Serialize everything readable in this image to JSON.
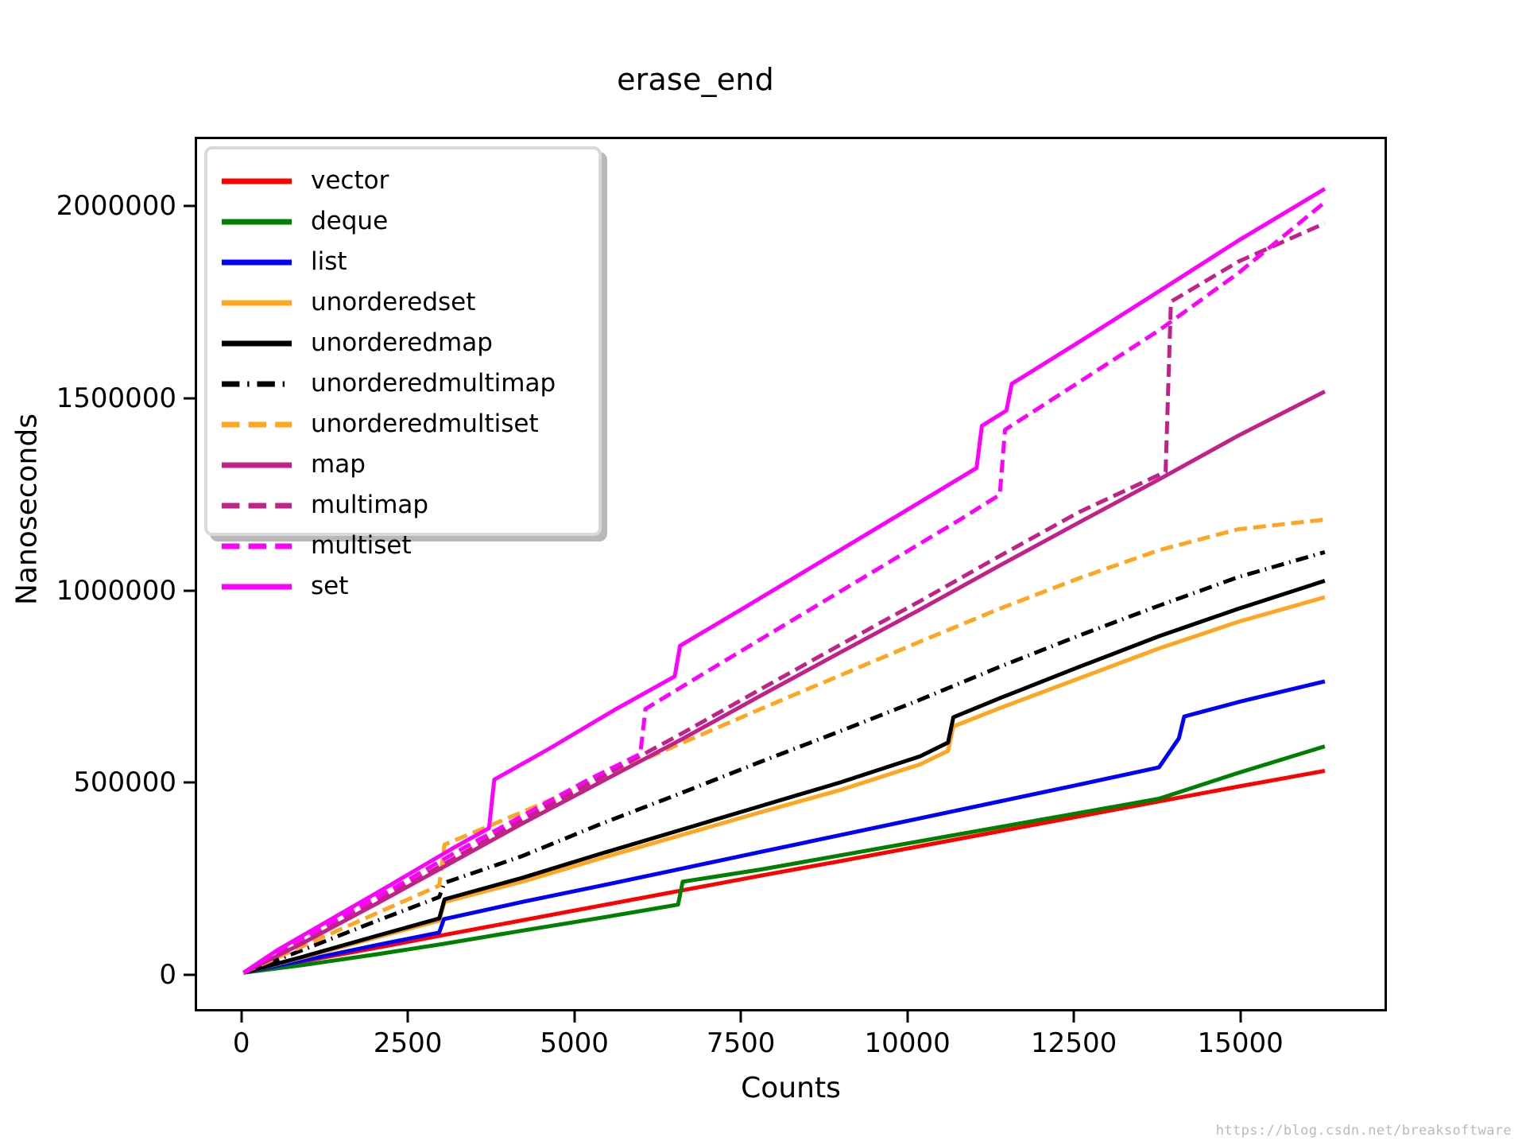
{
  "chart_data": {
    "type": "line",
    "title": "erase_end",
    "xlabel": "Counts",
    "ylabel": "Nanoseconds",
    "xlim": [
      -700,
      17200
    ],
    "ylim": [
      -95000,
      2180000
    ],
    "xticks": [
      0,
      2500,
      5000,
      7500,
      10000,
      12500,
      15000
    ],
    "xticklabels": [
      "0",
      "2500",
      "5000",
      "7500",
      "10000",
      "12500",
      "15000"
    ],
    "yticks": [
      0,
      500000,
      1000000,
      1500000,
      2000000
    ],
    "yticklabels": [
      "0",
      "500000",
      "1000000",
      "1500000",
      "2000000"
    ],
    "grid": false,
    "legend_position": "upper left",
    "series": [
      {
        "name": "vector",
        "color": "#ff0000",
        "style": "solid",
        "x": [
          0,
          900,
          2000,
          3000,
          4200,
          5400,
          6600,
          7800,
          9000,
          10200,
          11400,
          12600,
          13800,
          15000,
          16300
        ],
        "values": [
          0,
          30000,
          65000,
          98000,
          137000,
          176000,
          215000,
          254000,
          292000,
          331000,
          370000,
          409000,
          448000,
          487000,
          528000
        ]
      },
      {
        "name": "deque",
        "color": "#008000",
        "style": "solid",
        "x": [
          0,
          900,
          2000,
          3000,
          4200,
          5400,
          6550,
          6620,
          7800,
          9000,
          10200,
          11400,
          12600,
          13800,
          15000,
          16300
        ],
        "values": [
          0,
          20000,
          48000,
          75000,
          110000,
          144000,
          178000,
          238000,
          270000,
          307000,
          344000,
          381000,
          418000,
          455000,
          523000,
          592000
        ]
      },
      {
        "name": "list",
        "color": "#0000ff",
        "style": "solid",
        "x": [
          0,
          900,
          2000,
          2950,
          3020,
          4200,
          5400,
          6600,
          7800,
          9000,
          10200,
          11400,
          12600,
          13800,
          14100,
          14180,
          15000,
          16300
        ],
        "values": [
          0,
          32000,
          72000,
          105000,
          140000,
          185000,
          228000,
          272000,
          316000,
          360000,
          404000,
          448000,
          492000,
          537000,
          613000,
          670000,
          708000,
          762000
        ]
      },
      {
        "name": "unorderedset",
        "color": "#ffa51e",
        "style": "solid",
        "x": [
          0,
          900,
          2000,
          2950,
          3030,
          4200,
          5400,
          6600,
          7800,
          9000,
          10200,
          10620,
          10700,
          11400,
          12600,
          13800,
          15000,
          16300
        ],
        "values": [
          0,
          40000,
          92000,
          136000,
          185000,
          238000,
          300000,
          360000,
          420000,
          478000,
          545000,
          580000,
          644000,
          692000,
          770000,
          848000,
          918000,
          982000
        ]
      },
      {
        "name": "unorderedmap",
        "color": "#000000",
        "style": "solid",
        "x": [
          0,
          900,
          2000,
          2950,
          3030,
          4200,
          5400,
          6600,
          7800,
          9000,
          10200,
          10620,
          10700,
          11400,
          12600,
          13800,
          15000,
          16300
        ],
        "values": [
          0,
          42000,
          96000,
          142000,
          192000,
          248000,
          312000,
          374000,
          436000,
          498000,
          566000,
          602000,
          668000,
          718000,
          800000,
          880000,
          952000,
          1025000
        ]
      },
      {
        "name": "unorderedmultimap",
        "color": "#000000",
        "style": "dashdot",
        "x": [
          0,
          900,
          2000,
          2950,
          3030,
          4200,
          5400,
          6600,
          7800,
          9000,
          10200,
          11400,
          12600,
          13800,
          15000,
          16300
        ],
        "values": [
          0,
          60000,
          135000,
          198000,
          235000,
          305000,
          390000,
          470000,
          552000,
          632000,
          714000,
          800000,
          882000,
          960000,
          1035000,
          1100000
        ]
      },
      {
        "name": "unorderedmultiset",
        "color": "#ffa51e",
        "style": "dashed",
        "x": [
          0,
          900,
          2000,
          2950,
          3030,
          4200,
          5400,
          6600,
          7800,
          9000,
          10200,
          11400,
          12600,
          13800,
          15000,
          16300
        ],
        "values": [
          0,
          70000,
          155000,
          228000,
          335000,
          420000,
          510000,
          600000,
          690000,
          778000,
          866000,
          952000,
          1032000,
          1105000,
          1160000,
          1185000
        ]
      },
      {
        "name": "map",
        "color": "#c2218a",
        "style": "solid",
        "x": [
          0,
          900,
          2000,
          3000,
          4200,
          5400,
          6600,
          7800,
          9000,
          10200,
          11400,
          12600,
          13800,
          15000,
          16300
        ],
        "values": [
          0,
          78000,
          180000,
          275000,
          390000,
          500000,
          610000,
          725000,
          838000,
          950000,
          1065000,
          1178000,
          1290000,
          1405000,
          1520000
        ]
      },
      {
        "name": "multimap",
        "color": "#c2218a",
        "style": "dashed",
        "x": [
          0,
          900,
          2000,
          3000,
          4200,
          5400,
          6600,
          7800,
          9000,
          10200,
          11400,
          12600,
          13900,
          13980,
          15000,
          16300
        ],
        "values": [
          0,
          80000,
          185000,
          282000,
          400000,
          512000,
          625000,
          742000,
          858000,
          972000,
          1090000,
          1205000,
          1310000,
          1755000,
          1860000,
          1960000
        ]
      },
      {
        "name": "multiset",
        "color": "#ff00ff",
        "style": "dashed",
        "x": [
          0,
          500,
          1200,
          2200,
          3200,
          4200,
          5200,
          5980,
          6060,
          7200,
          8400,
          9600,
          10800,
          11400,
          11480,
          12600,
          13800,
          15000,
          16300
        ],
        "values": [
          0,
          55000,
          120000,
          215000,
          315000,
          410000,
          505000,
          572000,
          690000,
          810000,
          935000,
          1060000,
          1185000,
          1250000,
          1420000,
          1545000,
          1680000,
          1830000,
          2015000
        ]
      },
      {
        "name": "set",
        "color": "#ff00ff",
        "style": "solid",
        "x": [
          0,
          500,
          1200,
          2200,
          3200,
          3700,
          3780,
          4600,
          5600,
          6500,
          6580,
          7600,
          8800,
          10000,
          11050,
          11130,
          11500,
          11580,
          12600,
          13800,
          15000,
          16300
        ],
        "values": [
          0,
          58000,
          128000,
          228000,
          330000,
          378000,
          505000,
          585000,
          688000,
          775000,
          855000,
          960000,
          1085000,
          1210000,
          1320000,
          1430000,
          1470000,
          1540000,
          1650000,
          1782000,
          1915000,
          2050000
        ]
      }
    ]
  },
  "legend": {
    "items": [
      {
        "label": "vector"
      },
      {
        "label": "deque"
      },
      {
        "label": "list"
      },
      {
        "label": "unorderedset"
      },
      {
        "label": "unorderedmap"
      },
      {
        "label": "unorderedmultimap"
      },
      {
        "label": "unorderedmultiset"
      },
      {
        "label": "map"
      },
      {
        "label": "multimap"
      },
      {
        "label": "multiset"
      },
      {
        "label": "set"
      }
    ]
  },
  "watermark": {
    "text": "https://blog.csdn.net/breaksoftware"
  }
}
